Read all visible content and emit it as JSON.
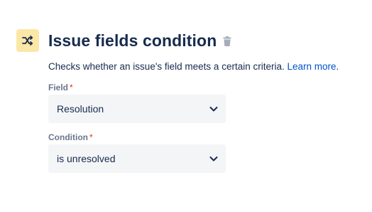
{
  "header": {
    "title": "Issue fields condition",
    "icon": "shuffle-icon",
    "icon_bg": "#fbe7a6",
    "delete_icon": "trash-icon"
  },
  "description": {
    "text": "Checks whether an issue's field meets a certain criteria.",
    "link_label": "Learn more",
    "suffix": "."
  },
  "fields": {
    "field": {
      "label": "Field",
      "required_mark": "*",
      "value": "Resolution"
    },
    "condition": {
      "label": "Condition",
      "required_mark": "*",
      "value": "is unresolved"
    }
  },
  "colors": {
    "text": "#172b4d",
    "link": "#0052cc",
    "required": "#de350b",
    "label": "#6b778c",
    "select_bg": "#f4f5f7"
  }
}
